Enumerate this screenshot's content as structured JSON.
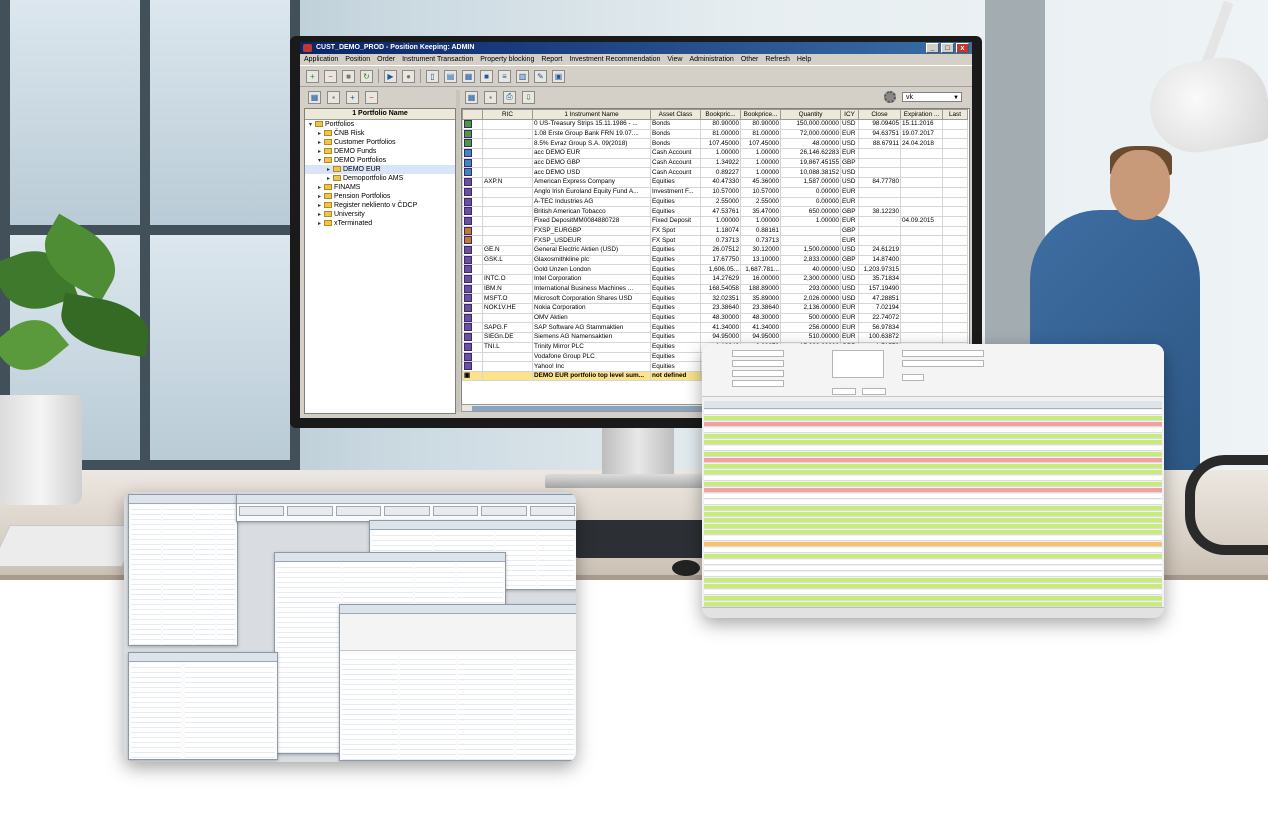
{
  "window": {
    "title": "CUST_DEMO_PROD - Position Keeping: ADMIN",
    "minimize": "_",
    "maximize": "□",
    "close": "x"
  },
  "menu": [
    "Application",
    "Position",
    "Order",
    "Instrument Transaction",
    "Property blocking",
    "Report",
    "Investment Recommendation",
    "View",
    "Administration",
    "Other",
    "Refresh",
    "Help"
  ],
  "tree": {
    "header": "1 Portfolio Name",
    "items": [
      {
        "label": "Portfolios",
        "level": 0,
        "expanded": true
      },
      {
        "label": "ČNB Risk",
        "level": 1
      },
      {
        "label": "Customer Portfolios",
        "level": 1
      },
      {
        "label": "DEMO Funds",
        "level": 1
      },
      {
        "label": "DEMO Portfolios",
        "level": 1,
        "expanded": true
      },
      {
        "label": "DEMO EUR",
        "level": 2,
        "selected": true
      },
      {
        "label": "Demoportfolio AMS",
        "level": 2
      },
      {
        "label": "FINAMS",
        "level": 1
      },
      {
        "label": "Pension Portfolios",
        "level": 1
      },
      {
        "label": "Register nekliento v ČDCP",
        "level": 1
      },
      {
        "label": "University",
        "level": 1
      },
      {
        "label": "xTerminated",
        "level": 1
      }
    ]
  },
  "grid": {
    "view_select": "vk",
    "columns": [
      "",
      "RIC",
      "1 Instrument Name",
      "Asset Class",
      "Bookpric...",
      "Bookprice...",
      "Quantity",
      "ICY",
      "Close",
      "Expiration ...",
      "Last"
    ],
    "rows": [
      {
        "type": "B",
        "ric": "",
        "name": "0 US-Treasury Strips 15.11.1986 - ...",
        "asset": "Bonds",
        "bp1": "80.90000",
        "bp2": "80.90000",
        "qty": "150,000.00000",
        "cy": "USD",
        "close": "98.09405",
        "exp": "15.11.2016"
      },
      {
        "type": "B",
        "ric": "",
        "name": "1.08 Erste Group Bank FRN 19.07....",
        "asset": "Bonds",
        "bp1": "81.00000",
        "bp2": "81.00000",
        "qty": "72,000.00000",
        "cy": "EUR",
        "close": "94.63751",
        "exp": "19.07.2017"
      },
      {
        "type": "B",
        "ric": "",
        "name": "8.5% Evraz Group S.A. 09(2018)",
        "asset": "Bonds",
        "bp1": "107.45000",
        "bp2": "107.45000",
        "qty": "48.00000",
        "cy": "USD",
        "close": "88.67911",
        "exp": "24.04.2018"
      },
      {
        "type": "CA",
        "ric": "",
        "name": "acc DEMO EUR",
        "asset": "Cash Account",
        "bp1": "1.00000",
        "bp2": "1.00000",
        "qty": "26,146.62283",
        "cy": "EUR",
        "close": "",
        "exp": ""
      },
      {
        "type": "CA",
        "ric": "",
        "name": "acc DEMO GBP",
        "asset": "Cash Account",
        "bp1": "1.34922",
        "bp2": "1.00000",
        "qty": "19,867.45155",
        "cy": "GBP",
        "close": "",
        "exp": ""
      },
      {
        "type": "CA",
        "ric": "",
        "name": "acc DEMO USD",
        "asset": "Cash Account",
        "bp1": "0.89227",
        "bp2": "1.00000",
        "qty": "10,088.38152",
        "cy": "USD",
        "close": "",
        "exp": ""
      },
      {
        "type": "E",
        "ric": "AXP.N",
        "name": "American Express Company",
        "asset": "Equities",
        "bp1": "40.47330",
        "bp2": "45.36000",
        "qty": "1,587.00000",
        "cy": "USD",
        "close": "84.77780",
        "exp": ""
      },
      {
        "type": "E",
        "ric": "",
        "name": "Anglo Irish Euroland Equity Fund A...",
        "asset": "Investment F...",
        "bp1": "10.57000",
        "bp2": "10.57000",
        "qty": "0.00000",
        "cy": "EUR",
        "close": "",
        "exp": ""
      },
      {
        "type": "E",
        "ric": "",
        "name": "A-TEC Industries AG",
        "asset": "Equities",
        "bp1": "2.55000",
        "bp2": "2.55000",
        "qty": "0.00000",
        "cy": "EUR",
        "close": "",
        "exp": ""
      },
      {
        "type": "E",
        "ric": "",
        "name": "British American Tobacco",
        "asset": "Equities",
        "bp1": "47.53761",
        "bp2": "35.47000",
        "qty": "650.00000",
        "cy": "GBP",
        "close": "38.12230",
        "exp": ""
      },
      {
        "type": "FD",
        "ric": "",
        "name": "Fixed DepositMM0084880728",
        "asset": "Fixed Deposit",
        "bp1": "1.00000",
        "bp2": "1.00000",
        "qty": "1.00000",
        "cy": "EUR",
        "close": "",
        "exp": "04.09.2015"
      },
      {
        "type": "FX",
        "ric": "",
        "name": "FXSP_EURGBP",
        "asset": "FX Spot",
        "bp1": "1.18074",
        "bp2": "0.88161",
        "qty": "",
        "cy": "GBP",
        "close": "",
        "exp": ""
      },
      {
        "type": "FX",
        "ric": "",
        "name": "FXSP_USDEUR",
        "asset": "FX Spot",
        "bp1": "0.73713",
        "bp2": "0.73713",
        "qty": "",
        "cy": "EUR",
        "close": "",
        "exp": ""
      },
      {
        "type": "E",
        "ric": "GE.N",
        "name": "General Electric Aktien (USD)",
        "asset": "Equities",
        "bp1": "26.07512",
        "bp2": "30.12000",
        "qty": "1,500.00000",
        "cy": "USD",
        "close": "24.61219",
        "exp": ""
      },
      {
        "type": "E",
        "ric": "GSK.L",
        "name": "Glaxosmithkline plc",
        "asset": "Equities",
        "bp1": "17.67750",
        "bp2": "13.10000",
        "qty": "2,833.00000",
        "cy": "GBP",
        "close": "14.87400",
        "exp": ""
      },
      {
        "type": "E",
        "ric": "",
        "name": "Gold Unzen London",
        "asset": "Equities",
        "bp1": "1,606.05...",
        "bp2": "1,687.781...",
        "qty": "40.00000",
        "cy": "USD",
        "close": "1,203.97315",
        "exp": ""
      },
      {
        "type": "E",
        "ric": "INTC.O",
        "name": "Intel Corporation",
        "asset": "Equities",
        "bp1": "14.27629",
        "bp2": "16.00000",
        "qty": "2,300.00000",
        "cy": "USD",
        "close": "35.71834",
        "exp": ""
      },
      {
        "type": "E",
        "ric": "IBM.N",
        "name": "International Business Machines ...",
        "asset": "Equities",
        "bp1": "168.54058",
        "bp2": "188.89000",
        "qty": "293.00000",
        "cy": "USD",
        "close": "157.19490",
        "exp": ""
      },
      {
        "type": "E",
        "ric": "MSFT.O",
        "name": "Microsoft Corporation Shares USD",
        "asset": "Equities",
        "bp1": "32.02351",
        "bp2": "35.89000",
        "qty": "2,026.00000",
        "cy": "USD",
        "close": "47.28851",
        "exp": ""
      },
      {
        "type": "E",
        "ric": "NOK1V.HE",
        "name": "Nokia Corporation",
        "asset": "Equities",
        "bp1": "23.38640",
        "bp2": "23.38640",
        "qty": "2,136.00000",
        "cy": "EUR",
        "close": "7.02194",
        "exp": ""
      },
      {
        "type": "E",
        "ric": "",
        "name": "OMV Aktien",
        "asset": "Equities",
        "bp1": "48.30000",
        "bp2": "48.30000",
        "qty": "500.00000",
        "cy": "EUR",
        "close": "22.74072",
        "exp": ""
      },
      {
        "type": "E",
        "ric": "SAPG.F",
        "name": "SAP Software AG Stammaktien",
        "asset": "Equities",
        "bp1": "41.34000",
        "bp2": "41.34000",
        "qty": "256.00000",
        "cy": "EUR",
        "close": "56.97834",
        "exp": ""
      },
      {
        "type": "E",
        "ric": "SIEGn.DE",
        "name": "Siemens AG Namensaktien",
        "asset": "Equities",
        "bp1": "94.95000",
        "bp2": "94.95000",
        "qty": "510.00000",
        "cy": "EUR",
        "close": "100.63872",
        "exp": ""
      },
      {
        "type": "E",
        "ric": "TNI.L",
        "name": "Trinity Mirror PLC",
        "asset": "Equities",
        "bp1": "1.10942",
        "bp2": "0.82278",
        "qty": "15,000.00000",
        "cy": "GBP",
        "close": "1.71570",
        "exp": ""
      },
      {
        "type": "E",
        "ric": "",
        "name": "Vodafone Group PLC",
        "asset": "Equities",
        "bp1": "",
        "bp2": "",
        "qty": "",
        "cy": "",
        "close": "",
        "exp": ""
      },
      {
        "type": "E",
        "ric": "",
        "name": "Yahoo! Inc",
        "asset": "Equities",
        "bp1": "",
        "bp2": "",
        "qty": "",
        "cy": "",
        "close": "",
        "exp": ""
      }
    ],
    "total_row": {
      "name": "DEMO EUR portfolio top level sum...",
      "asset": "not defined"
    }
  },
  "colors": {
    "title_bar": "#0a246a",
    "highlight_green": "#c7ec7a",
    "highlight_red": "#f2a1a1",
    "total_row": "#fbe38c"
  }
}
